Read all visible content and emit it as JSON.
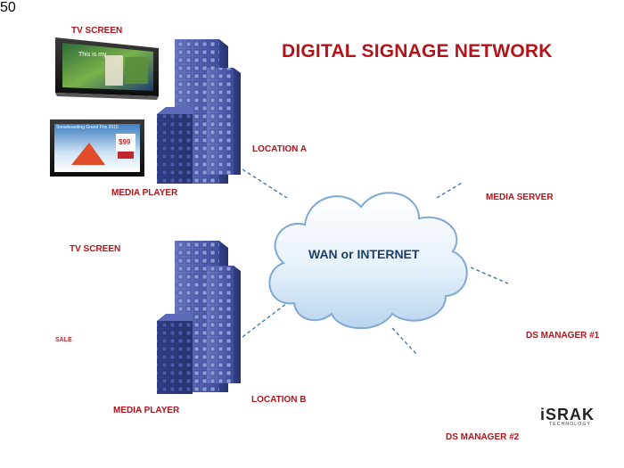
{
  "title": "DIGITAL SIGNAGE NETWORK",
  "cloud": {
    "label": "WAN or INTERNET"
  },
  "location_a": {
    "tv_screen_label": "TV SCREEN",
    "media_player_label": "MEDIA PLAYER",
    "location_label": "LOCATION A",
    "screen1_text": "This is my",
    "screen2_text": "Snowboarding Grand Prix 2015",
    "screen2_price": "$99"
  },
  "location_b": {
    "tv_screen_label": "TV SCREEN",
    "media_player_label": "MEDIA PLAYER",
    "location_label": "LOCATION B",
    "screen2_text": "SALE"
  },
  "right_side": {
    "media_server_label": "MEDIA SERVER",
    "ds_manager_1_label": "DS MANAGER #1",
    "ds_manager_2_label": "DS MANAGER #2"
  },
  "logo": {
    "name": "iSRAK",
    "tagline": "TECHNOLOGY"
  },
  "colors": {
    "label_red": "#b3141b",
    "cloud_text": "#1c3f63",
    "building_blue": "#4a5aa8",
    "link_dash": "#3d6fa8"
  }
}
